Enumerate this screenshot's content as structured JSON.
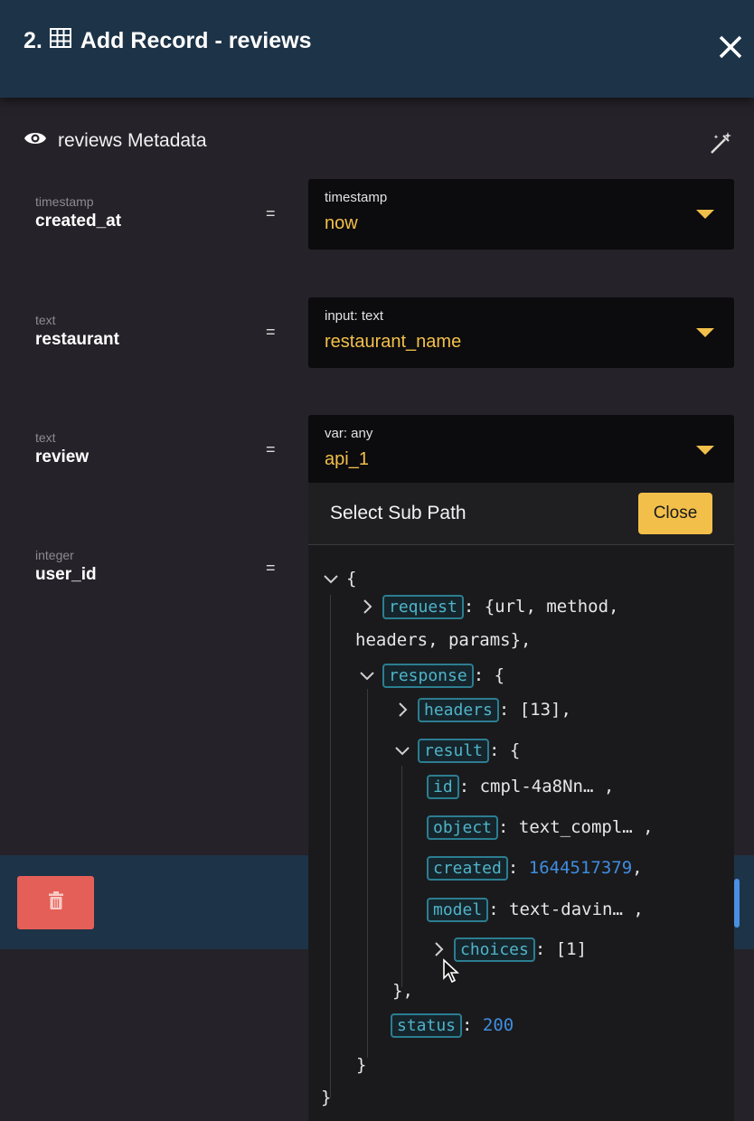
{
  "header": {
    "number": "2.",
    "title": "Add Record - reviews",
    "table_icon": "table-grid-icon",
    "close_icon": "close-icon"
  },
  "metadata": {
    "title": "reviews Metadata",
    "eye_icon": "eye-icon",
    "wand_icon": "magic-wand-icon"
  },
  "fields": [
    {
      "type": "timestamp",
      "name": "created_at",
      "eq": "=",
      "select_label": "timestamp",
      "select_value": "now"
    },
    {
      "type": "text",
      "name": "restaurant",
      "eq": "=",
      "select_label": "input: text",
      "select_value": "restaurant_name"
    },
    {
      "type": "text",
      "name": "review",
      "eq": "=",
      "select_label": "var: any",
      "select_value": "api_1"
    },
    {
      "type": "integer",
      "name": "user_id",
      "eq": "="
    }
  ],
  "subpath": {
    "title": "Select Sub Path",
    "close_label": "Close",
    "tree": {
      "root_open": "{",
      "request_key": "request",
      "request_value_1": ": {url, method,",
      "request_value_2": "headers, params},",
      "response_key": "response",
      "response_open": ": {",
      "headers_key": "headers",
      "headers_value": ": [13],",
      "result_key": "result",
      "result_open": ": {",
      "id_key": "id",
      "id_value": ": cmpl-4a8Nn… ,",
      "object_key": "object",
      "object_value": ": text_compl… ,",
      "created_key": "created",
      "created_sep": ": ",
      "created_value": "1644517379",
      "created_end": ",",
      "model_key": "model",
      "model_value": ": text-davin… ,",
      "choices_key": "choices",
      "choices_value": ": [1]",
      "result_close": "},",
      "status_key": "status",
      "status_sep": ": ",
      "status_value": "200",
      "response_close": "}",
      "root_close": "}"
    }
  },
  "colors": {
    "header_bg": "#1d3347",
    "panel_bg": "#252229",
    "accent": "#f2c04a",
    "danger": "#e45f57",
    "key_border": "#2c7d91",
    "number": "#3f8de0"
  }
}
